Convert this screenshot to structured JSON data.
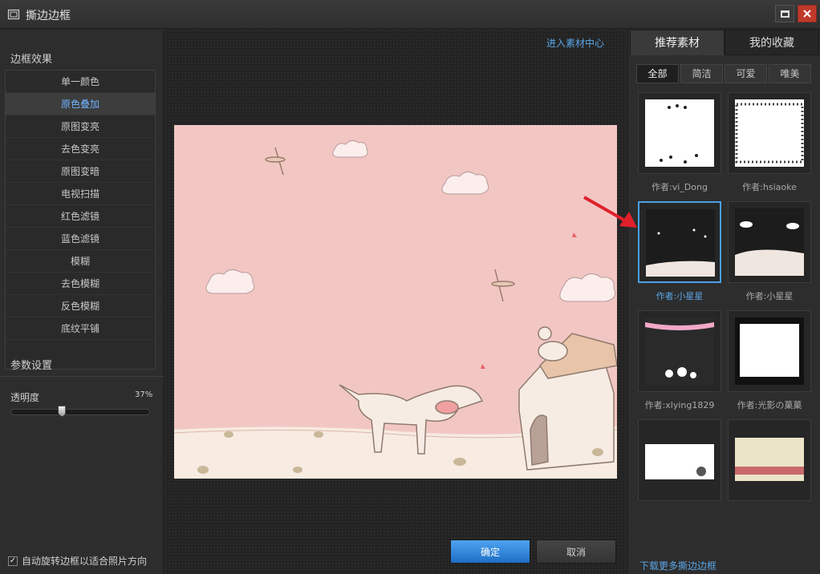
{
  "window": {
    "title": "撕边边框"
  },
  "left_panel": {
    "effects_title": "边框效果",
    "effects": [
      {
        "label": "单一颜色",
        "selected": false
      },
      {
        "label": "原色叠加",
        "selected": true
      },
      {
        "label": "原图变亮",
        "selected": false
      },
      {
        "label": "去色变亮",
        "selected": false
      },
      {
        "label": "原图变暗",
        "selected": false
      },
      {
        "label": "电视扫描",
        "selected": false
      },
      {
        "label": "红色滤镜",
        "selected": false
      },
      {
        "label": "蓝色滤镜",
        "selected": false
      },
      {
        "label": "模糊",
        "selected": false
      },
      {
        "label": "去色模糊",
        "selected": false
      },
      {
        "label": "反色模糊",
        "selected": false
      },
      {
        "label": "底纹平铺",
        "selected": false
      }
    ],
    "params_title": "参数设置",
    "opacity_label": "透明度",
    "opacity_value_text": "37%",
    "opacity_fraction": 0.37,
    "auto_rotate_label": "自动旋转边框以适合照片方向",
    "auto_rotate_checked": true
  },
  "center": {
    "material_center_link": "进入素材中心",
    "ok_label": "确定",
    "cancel_label": "取消"
  },
  "right_panel": {
    "tabs": [
      {
        "label": "推荐素材",
        "active": true
      },
      {
        "label": "我的收藏",
        "active": false
      }
    ],
    "filters": [
      {
        "label": "全部",
        "active": true
      },
      {
        "label": "简洁",
        "active": false
      },
      {
        "label": "可爱",
        "active": false
      },
      {
        "label": "唯美",
        "active": false
      }
    ],
    "thumbnails": [
      {
        "author": "作者:vi_Dong",
        "selected": false
      },
      {
        "author": "作者:hsiaoke",
        "selected": false
      },
      {
        "author": "作者:小星星",
        "selected": true
      },
      {
        "author": "作者:小星星",
        "selected": false
      },
      {
        "author": "作者:xlying1829",
        "selected": false
      },
      {
        "author": "作者:光影の菓菓",
        "selected": false
      },
      {
        "author": "",
        "selected": false
      },
      {
        "author": "",
        "selected": false
      }
    ],
    "download_more": "下载更多撕边边框"
  },
  "colors": {
    "accent_blue": "#4aa0e6",
    "link_blue": "#5aa6e6",
    "close_red": "#c0392b",
    "preview_pink": "#f2c7c3",
    "arrow_red": "#e0202a"
  },
  "icons": {
    "app": "frame-icon",
    "maximize": "maximize-icon",
    "close": "close-icon",
    "checkbox": "checkmark-icon"
  }
}
